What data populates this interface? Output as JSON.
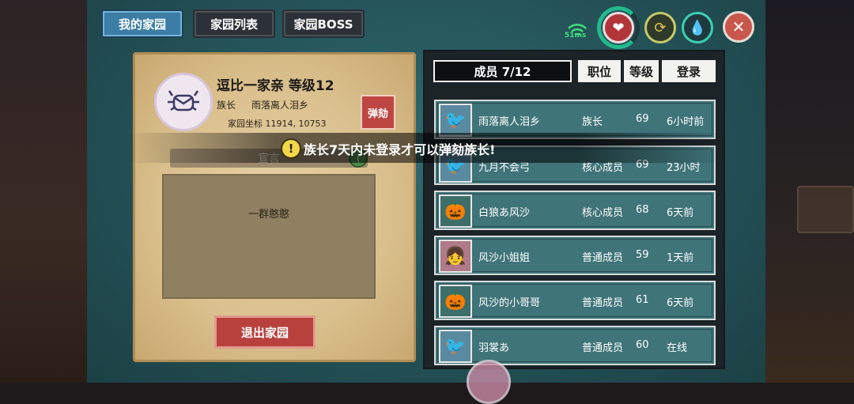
{
  "tabs": [
    {
      "label": "我的家园",
      "active": true
    },
    {
      "label": "家园列表",
      "active": false
    },
    {
      "label": "家园BOSS",
      "active": false
    }
  ],
  "status": {
    "ping": "51ms"
  },
  "icons": {
    "heart": "heart-icon",
    "rotate": "rotate-icon",
    "drop": "drop-icon",
    "close": "close-icon"
  },
  "family": {
    "title": "逗比一家亲 等级12",
    "leader_label": "族长",
    "leader_name": "雨落离人泪乡",
    "coords": "家园坐标 11914, 10753",
    "impeach_label": "弹劾",
    "notice_label": "宣言",
    "notice_text": "一群憨憨",
    "quit_label": "退出家园"
  },
  "toast": "族长7天内未登录才可以弹劾族长!",
  "members": {
    "headers": [
      "成员 7/12",
      "职位",
      "等级",
      "登录"
    ],
    "rows": [
      {
        "name": "雨落离人泪乡",
        "role": "族长",
        "level": "69",
        "login": "6小时前",
        "avatar": "white-bird"
      },
      {
        "name": "九月不会弓",
        "role": "核心成员",
        "level": "69",
        "login": "23小时",
        "avatar": "white-bird"
      },
      {
        "name": "白狼あ风沙",
        "role": "核心成员",
        "level": "68",
        "login": "6天前",
        "avatar": "pumpkin"
      },
      {
        "name": "风沙小姐姐",
        "role": "普通成员",
        "level": "59",
        "login": "1天前",
        "avatar": "girl"
      },
      {
        "name": "风沙的小哥哥",
        "role": "普通成员",
        "level": "61",
        "login": "6天前",
        "avatar": "pumpkin"
      },
      {
        "name": "羽裳あ",
        "role": "普通成员",
        "level": "60",
        "login": "在线",
        "avatar": "white-bird"
      }
    ]
  },
  "colors": {
    "panel": "#245257",
    "parchment": "#d9bf8c",
    "accent_red": "#bd4642",
    "ping_green": "#3fe07a"
  }
}
